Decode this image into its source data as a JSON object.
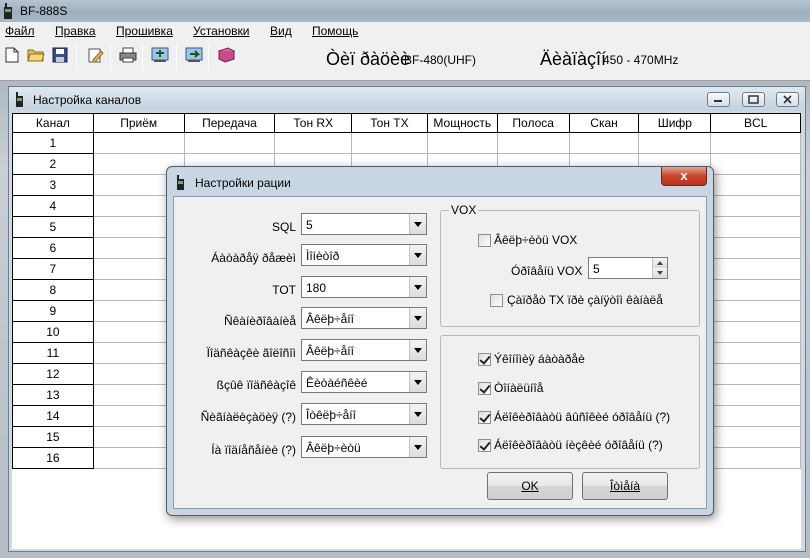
{
  "app": {
    "title": "BF-888S"
  },
  "menu": [
    "Файл",
    "Правка",
    "Прошивка",
    "Установки",
    "Вид",
    "Помощь"
  ],
  "toolbar": {
    "icons": [
      "new-file-icon",
      "open-folder-icon",
      "save-disk-icon",
      "edit-icon",
      "print-icon",
      "read-radio-icon",
      "write-radio-icon",
      "book-icon"
    ],
    "model_label": "Òèï ðàöèè",
    "model_value": "BF-480(UHF)",
    "band_label": "Äèàïàçîí",
    "band_value": "450 - 470MHz"
  },
  "channels_window": {
    "title": "Настройка каналов",
    "columns": [
      "Канал",
      "Приём",
      "Передача",
      "Тон RX",
      "Тон TX",
      "Мощность",
      "Полоса",
      "Скан",
      "Шифр",
      "BCL"
    ],
    "rows": [
      "1",
      "2",
      "3",
      "4",
      "5",
      "6",
      "7",
      "8",
      "9",
      "10",
      "11",
      "12",
      "13",
      "14",
      "15",
      "16"
    ]
  },
  "dialog": {
    "title": "Настройки рации",
    "close": "x",
    "fields": [
      {
        "label": "SQL",
        "value": "5"
      },
      {
        "label": "Áàòàðåÿ ðåæèì",
        "value": "Ìîíèòîð"
      },
      {
        "label": "TOT",
        "value": "180"
      },
      {
        "label": "Ñêàíèðîâàíèå",
        "value": "Âêëþ÷åíî"
      },
      {
        "label": "Ïîäñêàçêè ãîëîñîì",
        "value": "Âêëþ÷åíî"
      },
      {
        "label": "ßçûê ïîäñêàçîê",
        "value": "Êèòàéñêèé"
      },
      {
        "label": "Ñèãíàëèçàöèÿ (?)",
        "value": "Îòêëþ÷åíî"
      },
      {
        "label": "Íà ïîäíåñåíèè (?)",
        "value": "Âêëþ÷èòü"
      }
    ],
    "vox": {
      "title": "VOX",
      "enable_label": "Âêëþ÷èòü VOX",
      "enable_checked": false,
      "level_label": "Óðîâåíü VOX",
      "level_value": "5",
      "delay_label": "Çàïðåò TX ïðè çàíÿòîì êàíàëå",
      "delay_checked": false
    },
    "options": [
      {
        "label": "Ýêîíîìèÿ áàòàðåè",
        "checked": true
      },
      {
        "label": "Òîíàëüíîå",
        "checked": true
      },
      {
        "label": "Áëîêèðîâàòü âûñîêèé óðîâåíü (?)",
        "checked": true
      },
      {
        "label": "Áëîêèðîâàòü íèçêèé óðîâåíü (?)",
        "checked": true
      }
    ],
    "ok_label": "OK",
    "cancel_label": "Îòìåíà"
  },
  "colors": {
    "accent": "#c8452c",
    "frame": "#c8d6e3"
  }
}
